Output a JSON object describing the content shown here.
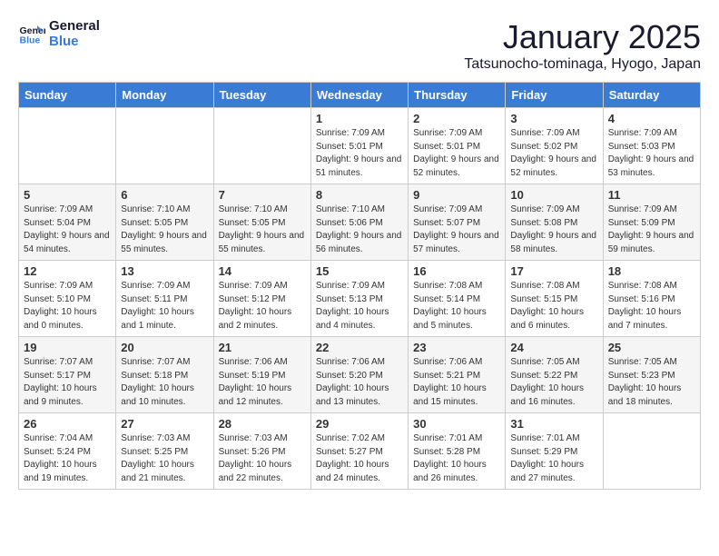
{
  "logo": {
    "line1": "General",
    "line2": "Blue"
  },
  "title": "January 2025",
  "subtitle": "Tatsunocho-tominaga, Hyogo, Japan",
  "days_of_week": [
    "Sunday",
    "Monday",
    "Tuesday",
    "Wednesday",
    "Thursday",
    "Friday",
    "Saturday"
  ],
  "weeks": [
    [
      {
        "day": "",
        "info": ""
      },
      {
        "day": "",
        "info": ""
      },
      {
        "day": "",
        "info": ""
      },
      {
        "day": "1",
        "info": "Sunrise: 7:09 AM\nSunset: 5:01 PM\nDaylight: 9 hours and 51 minutes."
      },
      {
        "day": "2",
        "info": "Sunrise: 7:09 AM\nSunset: 5:01 PM\nDaylight: 9 hours and 52 minutes."
      },
      {
        "day": "3",
        "info": "Sunrise: 7:09 AM\nSunset: 5:02 PM\nDaylight: 9 hours and 52 minutes."
      },
      {
        "day": "4",
        "info": "Sunrise: 7:09 AM\nSunset: 5:03 PM\nDaylight: 9 hours and 53 minutes."
      }
    ],
    [
      {
        "day": "5",
        "info": "Sunrise: 7:09 AM\nSunset: 5:04 PM\nDaylight: 9 hours and 54 minutes."
      },
      {
        "day": "6",
        "info": "Sunrise: 7:10 AM\nSunset: 5:05 PM\nDaylight: 9 hours and 55 minutes."
      },
      {
        "day": "7",
        "info": "Sunrise: 7:10 AM\nSunset: 5:05 PM\nDaylight: 9 hours and 55 minutes."
      },
      {
        "day": "8",
        "info": "Sunrise: 7:10 AM\nSunset: 5:06 PM\nDaylight: 9 hours and 56 minutes."
      },
      {
        "day": "9",
        "info": "Sunrise: 7:09 AM\nSunset: 5:07 PM\nDaylight: 9 hours and 57 minutes."
      },
      {
        "day": "10",
        "info": "Sunrise: 7:09 AM\nSunset: 5:08 PM\nDaylight: 9 hours and 58 minutes."
      },
      {
        "day": "11",
        "info": "Sunrise: 7:09 AM\nSunset: 5:09 PM\nDaylight: 9 hours and 59 minutes."
      }
    ],
    [
      {
        "day": "12",
        "info": "Sunrise: 7:09 AM\nSunset: 5:10 PM\nDaylight: 10 hours and 0 minutes."
      },
      {
        "day": "13",
        "info": "Sunrise: 7:09 AM\nSunset: 5:11 PM\nDaylight: 10 hours and 1 minute."
      },
      {
        "day": "14",
        "info": "Sunrise: 7:09 AM\nSunset: 5:12 PM\nDaylight: 10 hours and 2 minutes."
      },
      {
        "day": "15",
        "info": "Sunrise: 7:09 AM\nSunset: 5:13 PM\nDaylight: 10 hours and 4 minutes."
      },
      {
        "day": "16",
        "info": "Sunrise: 7:08 AM\nSunset: 5:14 PM\nDaylight: 10 hours and 5 minutes."
      },
      {
        "day": "17",
        "info": "Sunrise: 7:08 AM\nSunset: 5:15 PM\nDaylight: 10 hours and 6 minutes."
      },
      {
        "day": "18",
        "info": "Sunrise: 7:08 AM\nSunset: 5:16 PM\nDaylight: 10 hours and 7 minutes."
      }
    ],
    [
      {
        "day": "19",
        "info": "Sunrise: 7:07 AM\nSunset: 5:17 PM\nDaylight: 10 hours and 9 minutes."
      },
      {
        "day": "20",
        "info": "Sunrise: 7:07 AM\nSunset: 5:18 PM\nDaylight: 10 hours and 10 minutes."
      },
      {
        "day": "21",
        "info": "Sunrise: 7:06 AM\nSunset: 5:19 PM\nDaylight: 10 hours and 12 minutes."
      },
      {
        "day": "22",
        "info": "Sunrise: 7:06 AM\nSunset: 5:20 PM\nDaylight: 10 hours and 13 minutes."
      },
      {
        "day": "23",
        "info": "Sunrise: 7:06 AM\nSunset: 5:21 PM\nDaylight: 10 hours and 15 minutes."
      },
      {
        "day": "24",
        "info": "Sunrise: 7:05 AM\nSunset: 5:22 PM\nDaylight: 10 hours and 16 minutes."
      },
      {
        "day": "25",
        "info": "Sunrise: 7:05 AM\nSunset: 5:23 PM\nDaylight: 10 hours and 18 minutes."
      }
    ],
    [
      {
        "day": "26",
        "info": "Sunrise: 7:04 AM\nSunset: 5:24 PM\nDaylight: 10 hours and 19 minutes."
      },
      {
        "day": "27",
        "info": "Sunrise: 7:03 AM\nSunset: 5:25 PM\nDaylight: 10 hours and 21 minutes."
      },
      {
        "day": "28",
        "info": "Sunrise: 7:03 AM\nSunset: 5:26 PM\nDaylight: 10 hours and 22 minutes."
      },
      {
        "day": "29",
        "info": "Sunrise: 7:02 AM\nSunset: 5:27 PM\nDaylight: 10 hours and 24 minutes."
      },
      {
        "day": "30",
        "info": "Sunrise: 7:01 AM\nSunset: 5:28 PM\nDaylight: 10 hours and 26 minutes."
      },
      {
        "day": "31",
        "info": "Sunrise: 7:01 AM\nSunset: 5:29 PM\nDaylight: 10 hours and 27 minutes."
      },
      {
        "day": "",
        "info": ""
      }
    ]
  ]
}
